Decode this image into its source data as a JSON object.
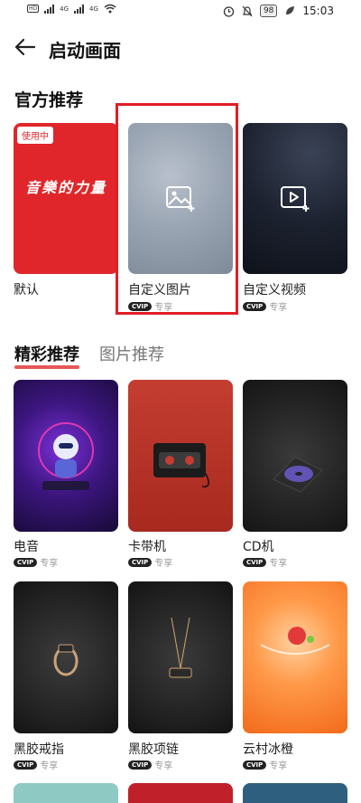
{
  "status": {
    "carrier_icons": [
      "HD",
      "HD",
      "4G",
      "4G"
    ],
    "battery": "98",
    "time": "15:03"
  },
  "header": {
    "title": "启动画面",
    "back_icon": "arrow-left-icon"
  },
  "official": {
    "title": "官方推荐",
    "items": [
      {
        "label": "默认",
        "badge": "使用中",
        "art_text": "音樂的力量"
      },
      {
        "label": "自定义图片",
        "vip": "专享"
      },
      {
        "label": "自定义视频",
        "vip": "专享"
      }
    ]
  },
  "tabs": [
    {
      "label": "精彩推荐",
      "active": true
    },
    {
      "label": "图片推荐",
      "active": false
    }
  ],
  "grid": [
    {
      "label": "电音",
      "vip": "专享"
    },
    {
      "label": "卡带机",
      "vip": "专享"
    },
    {
      "label": "CD机",
      "vip": "专享"
    },
    {
      "label": "黑胶戒指",
      "vip": "专享"
    },
    {
      "label": "黑胶项链",
      "vip": "专享"
    },
    {
      "label": "云村冰橙",
      "vip": "专享"
    }
  ],
  "vip_badge": "CVIP",
  "colors": {
    "accent": "#e21d26",
    "default_card": "#e0262a"
  }
}
